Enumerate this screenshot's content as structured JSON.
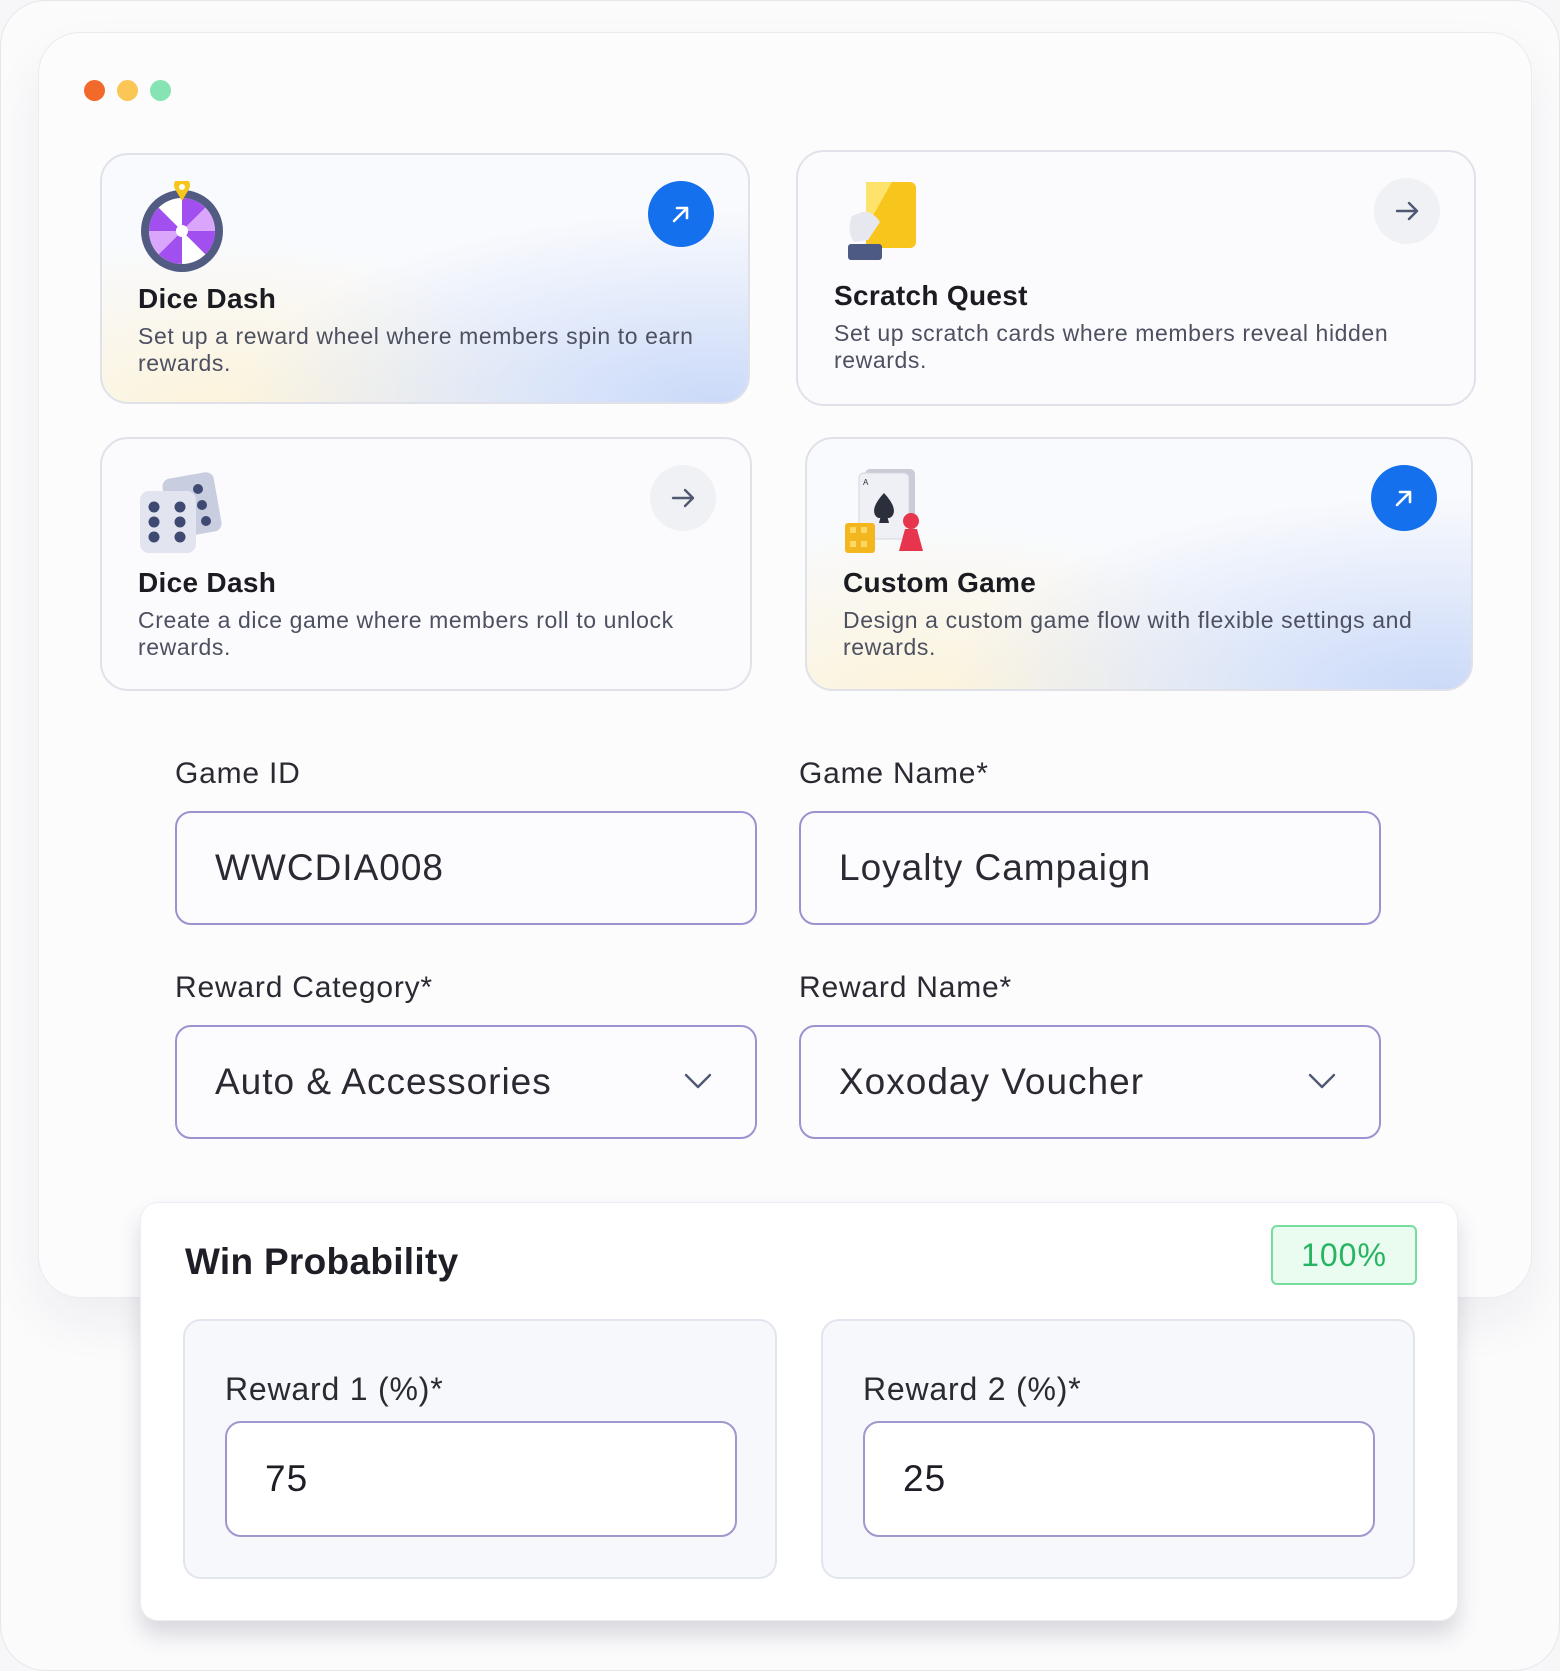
{
  "window": {
    "dots": [
      "#f26a2a",
      "#fac656",
      "#86e3b4"
    ]
  },
  "game_cards": [
    {
      "title": "Dice Dash",
      "description": "Set up a reward wheel where members spin to earn rewards.",
      "icon": "reward-wheel-icon",
      "action_icon": "arrow-up-right-icon",
      "style": "featured"
    },
    {
      "title": "Scratch Quest",
      "description": "Set up scratch cards where members reveal hidden rewards.",
      "icon": "scratch-card-icon",
      "action_icon": "arrow-right-icon",
      "style": "default"
    },
    {
      "title": "Dice Dash",
      "description": "Create a dice game where members roll to unlock rewards.",
      "icon": "dice-icon",
      "action_icon": "arrow-right-icon",
      "style": "default"
    },
    {
      "title": "Custom Game",
      "description": "Design a custom game flow with flexible settings and rewards.",
      "icon": "cards-game-icon",
      "action_icon": "arrow-up-right-icon",
      "style": "featured"
    }
  ],
  "form": {
    "game_id": {
      "label": "Game ID",
      "value": "WWCDIA008"
    },
    "game_name": {
      "label": "Game Name*",
      "value": "Loyalty Campaign"
    },
    "reward_category": {
      "label": "Reward Category*",
      "value": "Auto & Accessories"
    },
    "reward_name": {
      "label": "Reward Name*",
      "value": "Xoxoday Voucher"
    }
  },
  "win_probability": {
    "title": "Win Probability",
    "total_badge": "100%",
    "rewards": [
      {
        "label": "Reward 1 (%)*",
        "value": "75"
      },
      {
        "label": "Reward 2 (%)*",
        "value": "25"
      }
    ]
  },
  "colors": {
    "accent_blue": "#1570ee",
    "input_border": "#9d92cf",
    "success_green": "#27b562"
  }
}
